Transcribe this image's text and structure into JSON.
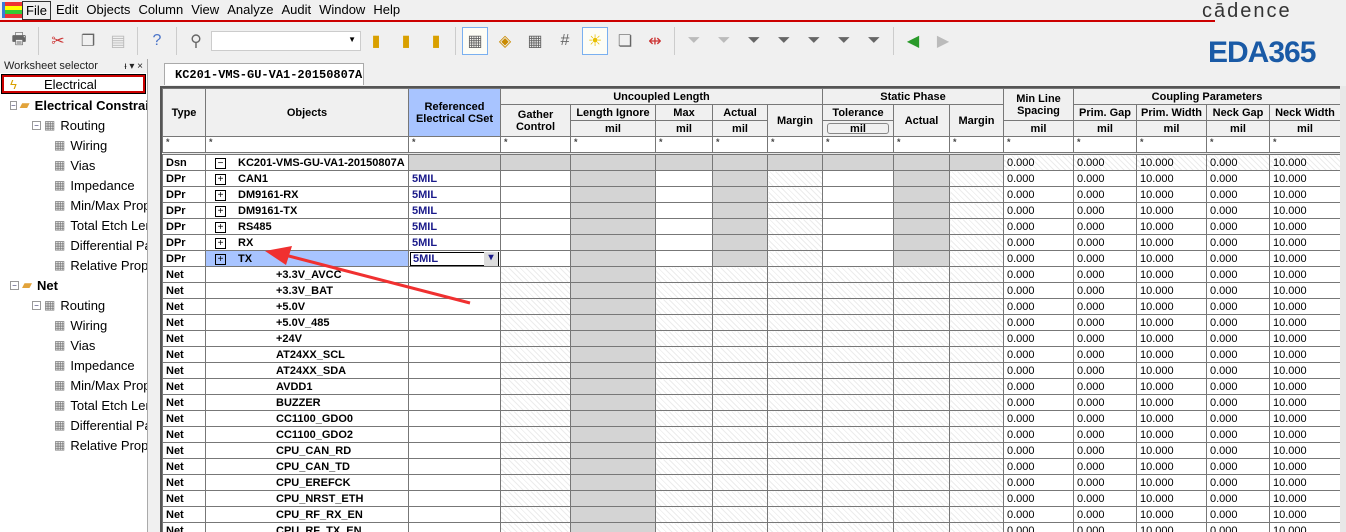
{
  "menu": [
    "File",
    "Edit",
    "Objects",
    "Column",
    "View",
    "Analyze",
    "Audit",
    "Window",
    "Help"
  ],
  "logo": {
    "cadence": "cādence",
    "eda": "EDA365"
  },
  "sidebar": {
    "title": "Worksheet selector",
    "pin": "ᵼ ▾ ×",
    "selected": "Electrical",
    "tree": [
      {
        "label": "Electrical Constraint Set",
        "level": 0,
        "kind": "folder",
        "bold": true
      },
      {
        "label": "Routing",
        "level": 1,
        "kind": "group"
      },
      {
        "label": "Wiring",
        "level": 2
      },
      {
        "label": "Vias",
        "level": 2
      },
      {
        "label": "Impedance",
        "level": 2
      },
      {
        "label": "Min/Max Propagation Delays",
        "level": 2
      },
      {
        "label": "Total Etch Length",
        "level": 2
      },
      {
        "label": "Differential Pair",
        "level": 2
      },
      {
        "label": "Relative Propagation Delay",
        "level": 2
      },
      {
        "label": "Net",
        "level": 0,
        "kind": "folder",
        "bold": true
      },
      {
        "label": "Routing",
        "level": 1,
        "kind": "group"
      },
      {
        "label": "Wiring",
        "level": 2
      },
      {
        "label": "Vias",
        "level": 2
      },
      {
        "label": "Impedance",
        "level": 2
      },
      {
        "label": "Min/Max Propagation Delays",
        "level": 2
      },
      {
        "label": "Total Etch Length",
        "level": 2
      },
      {
        "label": "Differential Pair",
        "level": 2
      },
      {
        "label": "Relative Propagation Delay",
        "level": 2
      }
    ]
  },
  "tab": "KC201-VMS-GU-VA1-20150807A",
  "headers": {
    "type": "Type",
    "objects": "Objects",
    "ref": "Referenced Electrical CSet",
    "uncoupled": "Uncoupled Length",
    "gather": "Gather Control",
    "len_ignore": "Length Ignore",
    "max": "Max",
    "actual": "Actual",
    "margin": "Margin",
    "static": "Static Phase",
    "tolerance": "Tolerance",
    "min_line": "Min Line Spacing",
    "coupling": "Coupling Parameters",
    "prim_gap": "Prim. Gap",
    "prim_width": "Prim. Width",
    "neck_gap": "Neck Gap",
    "neck_width": "Neck Width",
    "unit": "mil",
    "filter": "*"
  },
  "dsn": {
    "type": "Dsn",
    "name": "KC201-VMS-GU-VA1-20150807A",
    "min_line": "0.000",
    "prim_gap": "0.000",
    "prim_width": "10.000",
    "neck_gap": "0.000",
    "neck_width": "10.000"
  },
  "rows": [
    {
      "type": "DPr",
      "name": "CAN1",
      "ref": "5MIL"
    },
    {
      "type": "DPr",
      "name": "DM9161-RX",
      "ref": "5MIL"
    },
    {
      "type": "DPr",
      "name": "DM9161-TX",
      "ref": "5MIL"
    },
    {
      "type": "DPr",
      "name": "RS485",
      "ref": "5MIL"
    },
    {
      "type": "DPr",
      "name": "RX",
      "ref": "5MIL"
    },
    {
      "type": "DPr",
      "name": "TX",
      "ref": "5MIL",
      "selected": true
    },
    {
      "type": "Net",
      "name": "+3.3V_AVCC",
      "ref": ""
    },
    {
      "type": "Net",
      "name": "+3.3V_BAT",
      "ref": ""
    },
    {
      "type": "Net",
      "name": "+5.0V",
      "ref": ""
    },
    {
      "type": "Net",
      "name": "+5.0V_485",
      "ref": ""
    },
    {
      "type": "Net",
      "name": "+24V",
      "ref": ""
    },
    {
      "type": "Net",
      "name": "AT24XX_SCL",
      "ref": ""
    },
    {
      "type": "Net",
      "name": "AT24XX_SDA",
      "ref": ""
    },
    {
      "type": "Net",
      "name": "AVDD1",
      "ref": ""
    },
    {
      "type": "Net",
      "name": "BUZZER",
      "ref": ""
    },
    {
      "type": "Net",
      "name": "CC1100_GDO0",
      "ref": ""
    },
    {
      "type": "Net",
      "name": "CC1100_GDO2",
      "ref": ""
    },
    {
      "type": "Net",
      "name": "CPU_CAN_RD",
      "ref": ""
    },
    {
      "type": "Net",
      "name": "CPU_CAN_TD",
      "ref": ""
    },
    {
      "type": "Net",
      "name": "CPU_EREFCK",
      "ref": ""
    },
    {
      "type": "Net",
      "name": "CPU_NRST_ETH",
      "ref": ""
    },
    {
      "type": "Net",
      "name": "CPU_RF_RX_EN",
      "ref": ""
    },
    {
      "type": "Net",
      "name": "CPU_RF_TX_EN",
      "ref": ""
    }
  ],
  "row_values": {
    "min_line": "0.000",
    "prim_gap": "0.000",
    "prim_width": "10.000",
    "neck_gap": "0.000",
    "neck_width": "10.000"
  }
}
